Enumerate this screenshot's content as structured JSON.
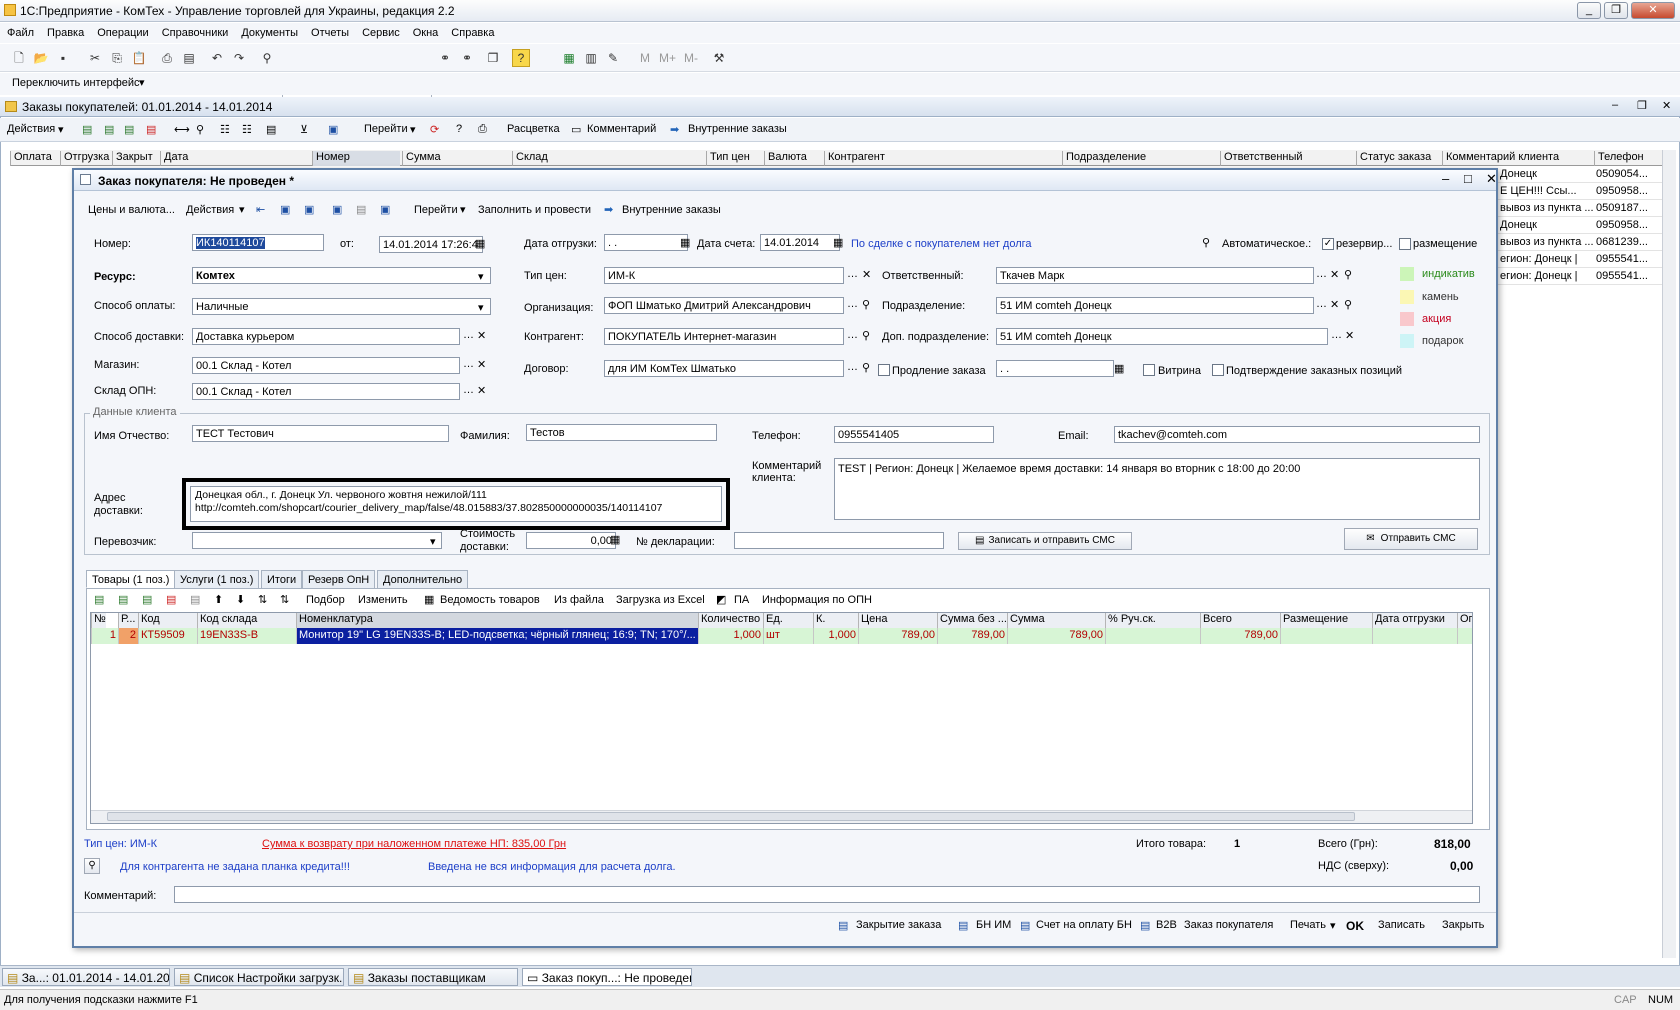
{
  "app": {
    "title": "1С:Предприятие - КомТех - Управление торговлей для Украины, редакция 2.2"
  },
  "menu": [
    "Файл",
    "Правка",
    "Операции",
    "Справочники",
    "Документы",
    "Отчеты",
    "Сервис",
    "Окна",
    "Справка"
  ],
  "switch_iface": "Переключить интерфейс",
  "list_window": {
    "title": "Заказы покупателей: 01.01.2014 - 14.01.2014",
    "actions": "Действия",
    "goto": "Перейти",
    "coloring": "Расцветка",
    "comment": "Комментарий",
    "internal": "Внутренние заказы",
    "columns": [
      "Оплата",
      "Отгрузка",
      "Закрыт",
      "Дата",
      "Номер",
      "Сумма",
      "Склад",
      "Тип цен",
      "Валюта",
      "Контрагент",
      "Подразделение",
      "Ответственный",
      "Статус заказа",
      "Комментарий клиента",
      "Телефон"
    ],
    "right_rows": [
      {
        "c": "Донецк",
        "p": "0509054..."
      },
      {
        "c": "Е ЦЕН!!!   Ссы...",
        "p": "0950958..."
      },
      {
        "c": "вывоз из пункта ...",
        "p": "0509187..."
      },
      {
        "c": "Донецк",
        "p": "0950958..."
      },
      {
        "c": "вывоз из пункта ...",
        "p": "0681239..."
      },
      {
        "c": "егион: Донецк |",
        "p": "0955541..."
      },
      {
        "c": "егион: Донецк |",
        "p": "0955541..."
      }
    ]
  },
  "dialog": {
    "title": "Заказ покупателя: Не проведен *",
    "toolbar": {
      "prices": "Цены и валюта...",
      "actions": "Действия",
      "goto": "Перейти",
      "fill": "Заполнить и провести",
      "internal": "Внутренние заказы"
    },
    "number_label": "Номер:",
    "number": "ИК140114107",
    "from_label": "от:",
    "date": "14.01.2014 17:26:4",
    "ship_date_label": "Дата отгрузки:",
    "ship_date": " .  .",
    "invoice_date_label": "Дата счета:",
    "invoice_date": "14.01.2014",
    "debt_link": "По сделке с покупателем нет долга",
    "auto_label": "Автоматическое.:",
    "reserve_label": "резервир...",
    "placement_label": "размещение",
    "resource_label": "Ресурс:",
    "resource": "Комтех",
    "payment_label": "Способ оплаты:",
    "payment": "Наличные",
    "delivery_label": "Способ доставки:",
    "delivery": "Доставка курьером",
    "store_label": "Магазин:",
    "store": "00.1 Склад - Котел",
    "opn_label": "Склад ОПН:",
    "opn": "00.1 Склад - Котел",
    "price_type_label": "Тип цен:",
    "price_type": "ИМ-К",
    "org_label": "Организация:",
    "org": "ФОП Шматько Дмитрий Александрович",
    "contractor_label": "Контрагент:",
    "contractor": "ПОКУПАТЕЛЬ Интернет-магазин",
    "contract_label": "Договор:",
    "contract": "для ИМ КомТех Шматько",
    "extend_label": "Продление заказа",
    "extend_date": " .  .",
    "vitrina_label": "Витрина",
    "confirm_label": "Подтверждение заказных позиций",
    "resp_label": "Ответственный:",
    "resp": "Ткачев Марк",
    "dept_label": "Подразделение:",
    "dept": "51 ИМ comteh Донецк",
    "dept2_label": "Доп. подразделение:",
    "dept2": "51 ИМ comteh Донецк",
    "legend": [
      {
        "t": "индикатив",
        "c": "#ccf5b8",
        "fc": "#2a8a1a"
      },
      {
        "t": "камень",
        "c": "#fbf7b4",
        "fc": "#333333"
      },
      {
        "t": "акция",
        "c": "#f9c8cc",
        "fc": "#c4001f"
      },
      {
        "t": "подарок",
        "c": "#cdf4f6",
        "fc": "#333333"
      }
    ],
    "client_group": "Данные клиента",
    "name_label": "Имя Отчество:",
    "name": "ТЕСТ Тестович",
    "surname_label": "Фамилия:",
    "surname": "Тестов",
    "phone_label": "Телефон:",
    "phone": "0955541405",
    "email_label": "Email:",
    "email": "tkachev@comteh.com",
    "addr_label1": "Адрес",
    "addr_label2": "доставки:",
    "addr1": "Донецкая обл., г. Донецк Ул. червоного жовтня нежилой/111",
    "addr2": "http://comteh.com/shopcart/courier_delivery_map/false/48.015883/37.802850000000035/140114107",
    "cc_label1": "Комментарий",
    "cc_label2": "клиента:",
    "client_comment": "TEST  |  Регион: Донецк |   Желаемое время доставки: 14 января во вторник с 18:00 до 20:00",
    "carrier_label": "Перевозчик:",
    "cost_label1": "Стоимость",
    "cost_label2": "доставки:",
    "cost": "0,00",
    "decl_label": "№ декларации:",
    "sms_write": "Записать и отправить СМС",
    "sms_send": "Отправить СМС",
    "tabs": [
      "Товары (1 поз.)",
      "Услуги (1 поз.)",
      "Итоги",
      "Резерв ОпН",
      "Дополнительно"
    ],
    "tab_tb": [
      "Подбор",
      "Изменить",
      "Ведомость товаров",
      "Из файла",
      "Загрузка из Excel",
      "ПА",
      "Информация по ОПН"
    ],
    "table_cols": [
      "№",
      "Р...",
      "Код",
      "Код склада",
      "Номенклатура",
      "Количество",
      "Ед.",
      "К.",
      "Цена",
      "Сумма без ...",
      "Сумма",
      "% Руч.ск.",
      "Всего",
      "Размещение",
      "Дата отгрузки",
      "Ог"
    ],
    "row": {
      "n": "1",
      "r": "2",
      "code": "КТ59509",
      "scode": "19EN33S-B",
      "name": "Монитор 19\" LG 19EN33S-B; LED-подсветка; чёрный глянец; 16:9; TN; 170°/...",
      "qty": "1,000",
      "unit": "шт",
      "k": "1,000",
      "price": "789,00",
      "sum_no": "789,00",
      "sum": "789,00",
      "total": "789,00"
    },
    "price_type_footer": "Тип цен: ИМ-К",
    "refund": "Сумма к возврату при наложенном платеже НП: 835,00 Грн",
    "total_items_label": "Итого товара:",
    "total_items": "1",
    "total_label": "Всего (Грн):",
    "total": "818,00",
    "vat_label": "НДС (сверху):",
    "vat": "0,00",
    "credit_warn": "Для контрагента не задана планка кредита!!!",
    "debt_warn": "Введена не вся информация для расчета долга.",
    "comment_label": "Комментарий:",
    "bottom": [
      "Закрытие заказа",
      "БН ИМ",
      "Счет на оплату БН",
      "B2B",
      "Заказ покупателя",
      "Печать",
      "OK",
      "Записать",
      "Закрыть"
    ]
  },
  "taskbar": [
    "За...: 01.01.2014 - 14.01.2014",
    "Список Настройки загрузк...",
    "Заказы поставщикам",
    "Заказ покуп...: Не проведен *"
  ],
  "status": {
    "hint": "Для получения подсказки нажмите F1",
    "cap": "CAP",
    "num": "NUM"
  }
}
